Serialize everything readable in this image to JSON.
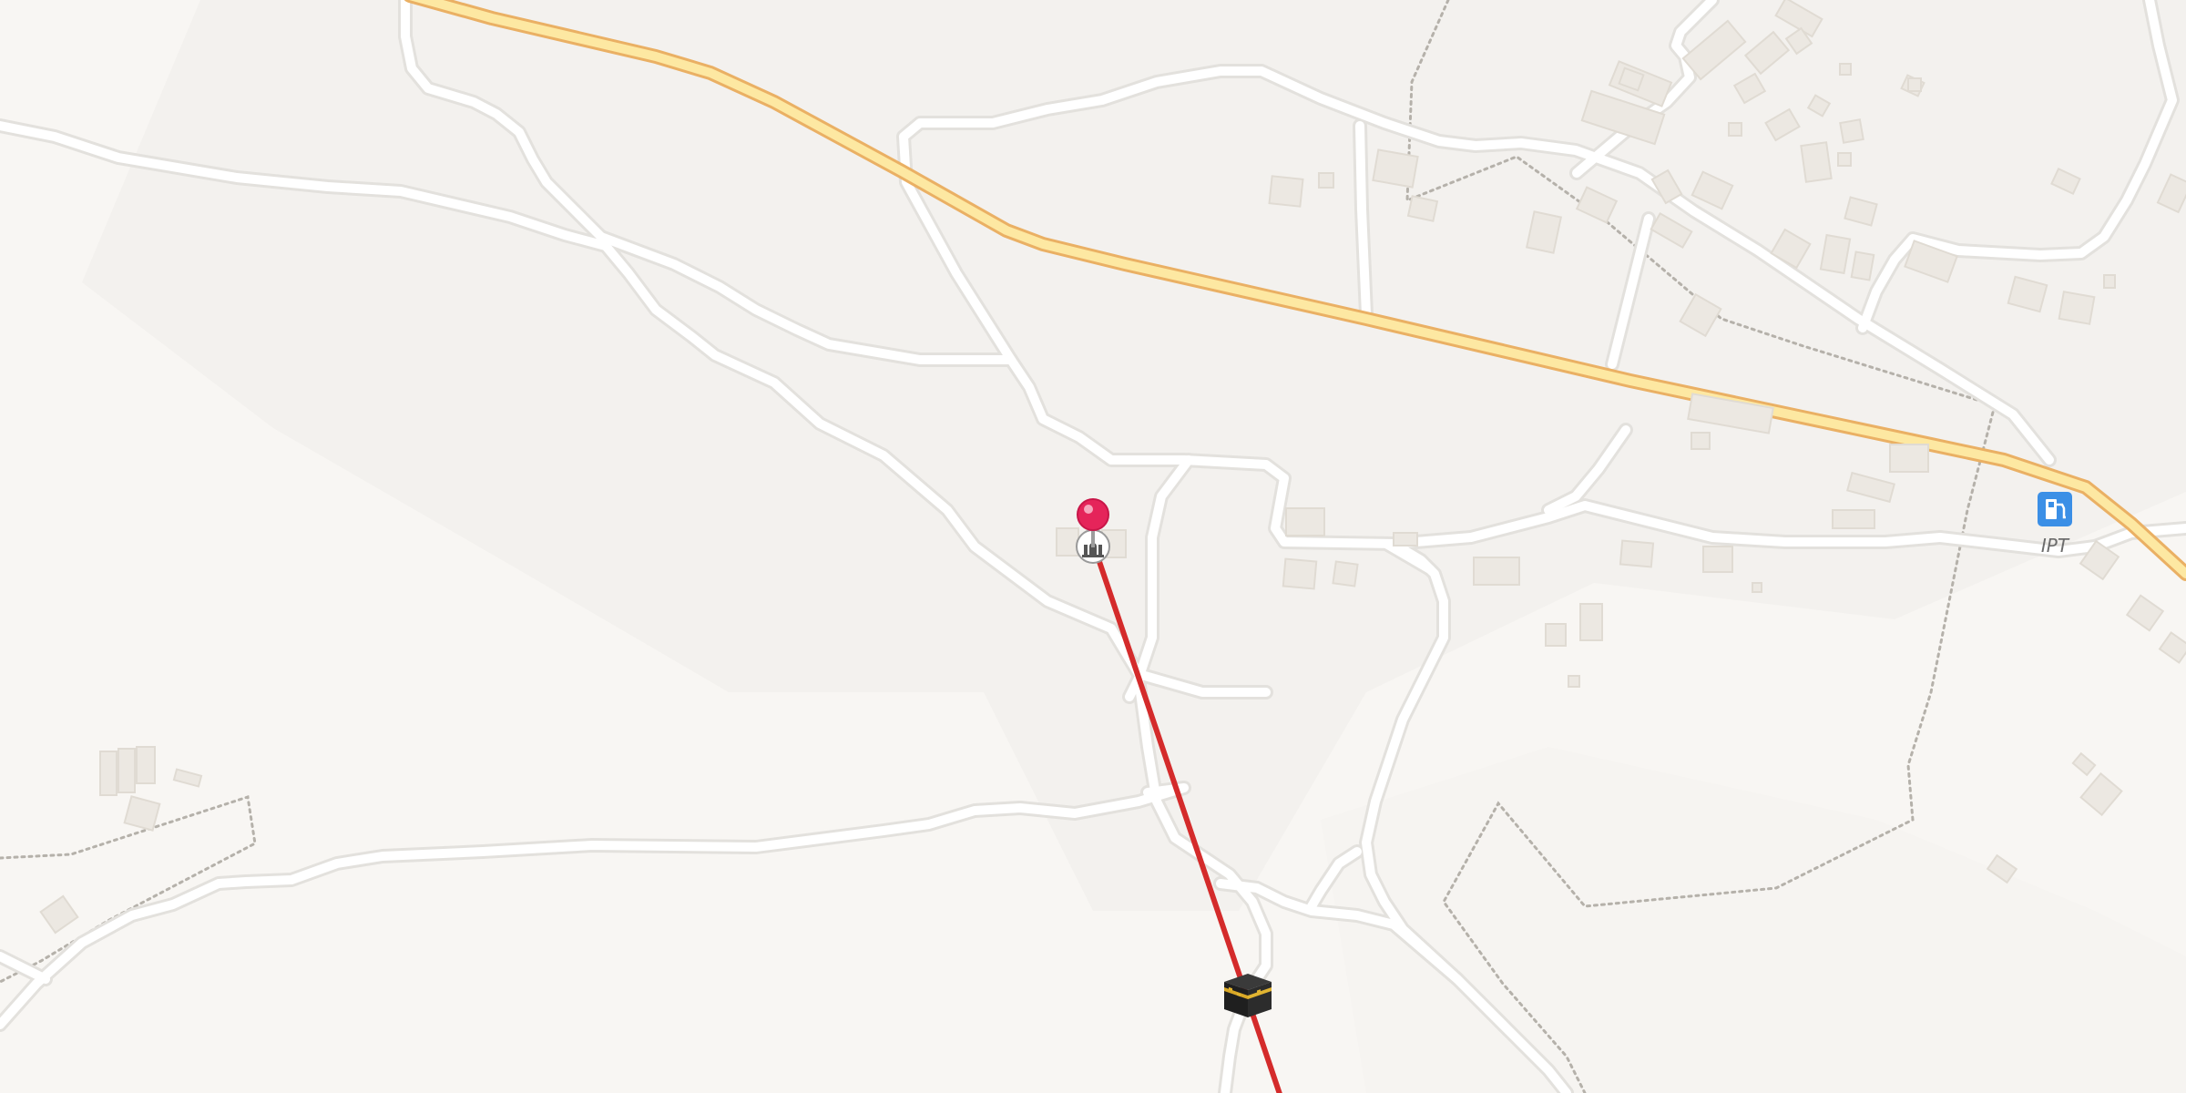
{
  "map": {
    "kind": "street-map",
    "colors": {
      "background": "#f8f6f3",
      "landuse": "#f3f1ee",
      "road_fill": "#ffffff",
      "road_casing": "#e3e1dd",
      "highway_fill": "#fde8a2",
      "highway_casing": "#eab064",
      "building": "#ece8e2",
      "building_edge": "#e0dbd3",
      "path": "#b5b1aa",
      "qibla_line": "#d42b2b",
      "pin": "#e5245a",
      "fuel_icon": "#3b8fe6"
    },
    "pois": [
      {
        "name": "fuel-station",
        "icon": "fuel-pump-icon",
        "label": "IPT"
      },
      {
        "name": "mosque",
        "icon": "mosque-icon",
        "label": ""
      },
      {
        "name": "kaaba",
        "icon": "kaaba-icon",
        "label": ""
      }
    ],
    "markers": [
      {
        "name": "current-location-pin",
        "icon": "map-pin-icon"
      }
    ],
    "lines": [
      {
        "name": "qibla-direction-line",
        "color": "#d42b2b"
      }
    ]
  }
}
